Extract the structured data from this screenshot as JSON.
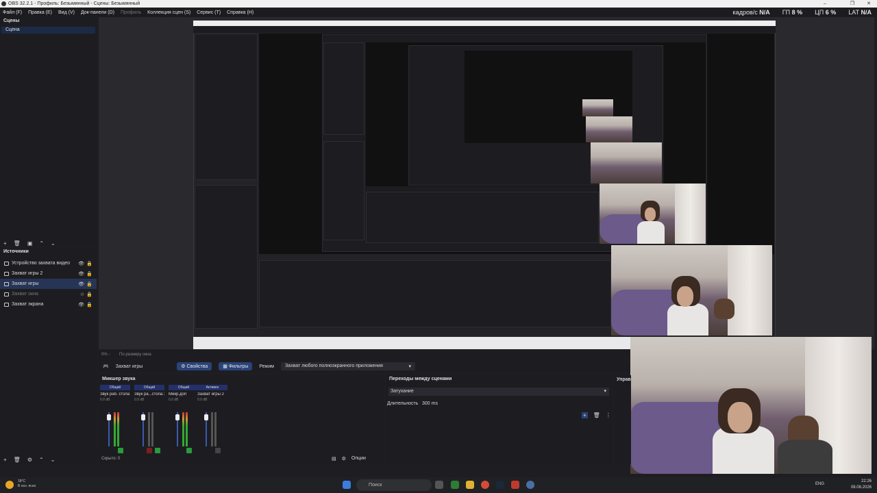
{
  "window": {
    "title": "OBS 32.2.1 - Профиль: Безымянный - Сцены: Безымянный",
    "controls": [
      "–",
      "❐",
      "✕"
    ]
  },
  "menu": [
    {
      "label": "Файл (F)",
      "disabled": false
    },
    {
      "label": "Правка (E)",
      "disabled": false
    },
    {
      "label": "Вид (V)",
      "disabled": false
    },
    {
      "label": "Док-панели (D)",
      "disabled": false
    },
    {
      "label": "Профиль",
      "disabled": true
    },
    {
      "label": "Коллекция сцен (S)",
      "disabled": false
    },
    {
      "label": "Сервис (T)",
      "disabled": false
    },
    {
      "label": "Справка (H)",
      "disabled": false
    }
  ],
  "stats": {
    "fps_label": "кадров/с",
    "fps_value": "N/A",
    "gpu_label": "ГП",
    "gpu_value": "8 %",
    "cpu_label": "ЦП",
    "cpu_value": "6 %",
    "lat_label": "LAT",
    "lat_value": "N/A"
  },
  "scenes": {
    "title": "Сцены",
    "items": [
      "Сцена"
    ]
  },
  "sources": {
    "title": "Источники",
    "items": [
      {
        "label": "Устройство захвата видео",
        "hidden": false,
        "selected": false
      },
      {
        "label": "Захват игры 2",
        "hidden": false,
        "selected": false
      },
      {
        "label": "Захват игры",
        "hidden": false,
        "selected": true
      },
      {
        "label": "Захват окна",
        "hidden": true,
        "selected": false
      },
      {
        "label": "Захват экрана",
        "hidden": false,
        "selected": false
      }
    ]
  },
  "source_bar": {
    "ctx_left": "0% -",
    "ctx_right": "По размеру окна",
    "source_name": "Захват игры",
    "properties": "Свойства",
    "filters": "Фильтры",
    "mode_label": "Режим",
    "mode_value": "Захват любого полноэкранного приложения"
  },
  "mixer": {
    "title": "Микшер звука",
    "channels": [
      {
        "tag": "Общий",
        "name": "Звук раб. стола",
        "db": "0.0 dB"
      },
      {
        "tag": "Общий",
        "name": "Звук ра...стола 2",
        "db": "0.0 dB"
      },
      {
        "tag": "Общий",
        "name": "Микр.доп",
        "db": "0.0 dB"
      },
      {
        "tag": "Активен",
        "name": "Захват игры 2",
        "db": "0.0 dB"
      }
    ],
    "hidden_count": "Скрыто: 0",
    "options": "Опции"
  },
  "transitions": {
    "title": "Переходы между сценами",
    "type": "Затухание",
    "duration_label": "Длительность",
    "duration_value": "300 ms"
  },
  "controls": {
    "title": "Управ"
  },
  "taskbar": {
    "weather_temp": "18°C",
    "weather_desc": "В осн. ясно",
    "search": "Поиск",
    "lang": "ENG",
    "time": "22:26",
    "date": "08.08.2026"
  },
  "colors": {
    "accent": "#2a4378",
    "selection": "#263456",
    "meter_green": "#3a3",
    "meter_red": "#c33"
  }
}
